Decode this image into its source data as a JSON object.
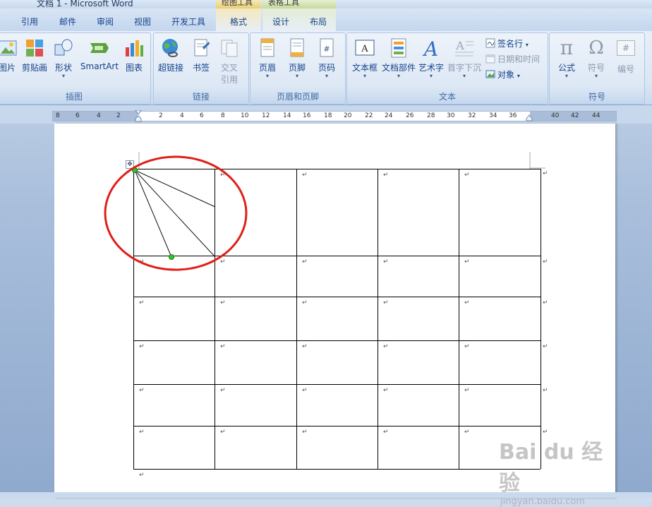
{
  "window": {
    "title": "文档 1 - Microsoft Word",
    "context_tabs": [
      "绘图工具",
      "表格工具"
    ]
  },
  "tabs": [
    "引用",
    "邮件",
    "审阅",
    "视图",
    "开发工具",
    "格式",
    "设计",
    "布局"
  ],
  "ribbon": {
    "groups": {
      "illustrations": {
        "label": "插图",
        "buttons": [
          "图片",
          "剪贴画",
          "形状",
          "SmartArt",
          "图表"
        ]
      },
      "links": {
        "label": "链接",
        "buttons": [
          "超链接",
          "书签"
        ],
        "cross_ref_line1": "交叉",
        "cross_ref_line2": "引用"
      },
      "header_footer": {
        "label": "页眉和页脚",
        "buttons": [
          "页眉",
          "页脚",
          "页码"
        ]
      },
      "text": {
        "label": "文本",
        "buttons": [
          "文本框",
          "文档部件",
          "艺术字",
          "首字下沉"
        ],
        "small": [
          "签名行",
          "日期和时间",
          "对象"
        ]
      },
      "symbols": {
        "label": "符号",
        "buttons": [
          "公式",
          "符号",
          "编号"
        ],
        "glyphs": [
          "π",
          "Ω",
          "#"
        ]
      }
    }
  },
  "ruler": {
    "ticks": [
      "8",
      "6",
      "4",
      "2",
      "2",
      "4",
      "6",
      "8",
      "10",
      "12",
      "14",
      "16",
      "18",
      "20",
      "22",
      "24",
      "26",
      "28",
      "30",
      "32",
      "34",
      "36",
      "40",
      "42",
      "44"
    ]
  },
  "table": {
    "rows": 6,
    "cols": 5,
    "cell_mark": "↵"
  },
  "watermark": {
    "text": "Bai du 经验",
    "url": "jingyan.baidu.com"
  },
  "colors": {
    "annotation_ellipse": "#e0201a",
    "handle": "#22cc22",
    "ribbon_text": "#15428b"
  }
}
